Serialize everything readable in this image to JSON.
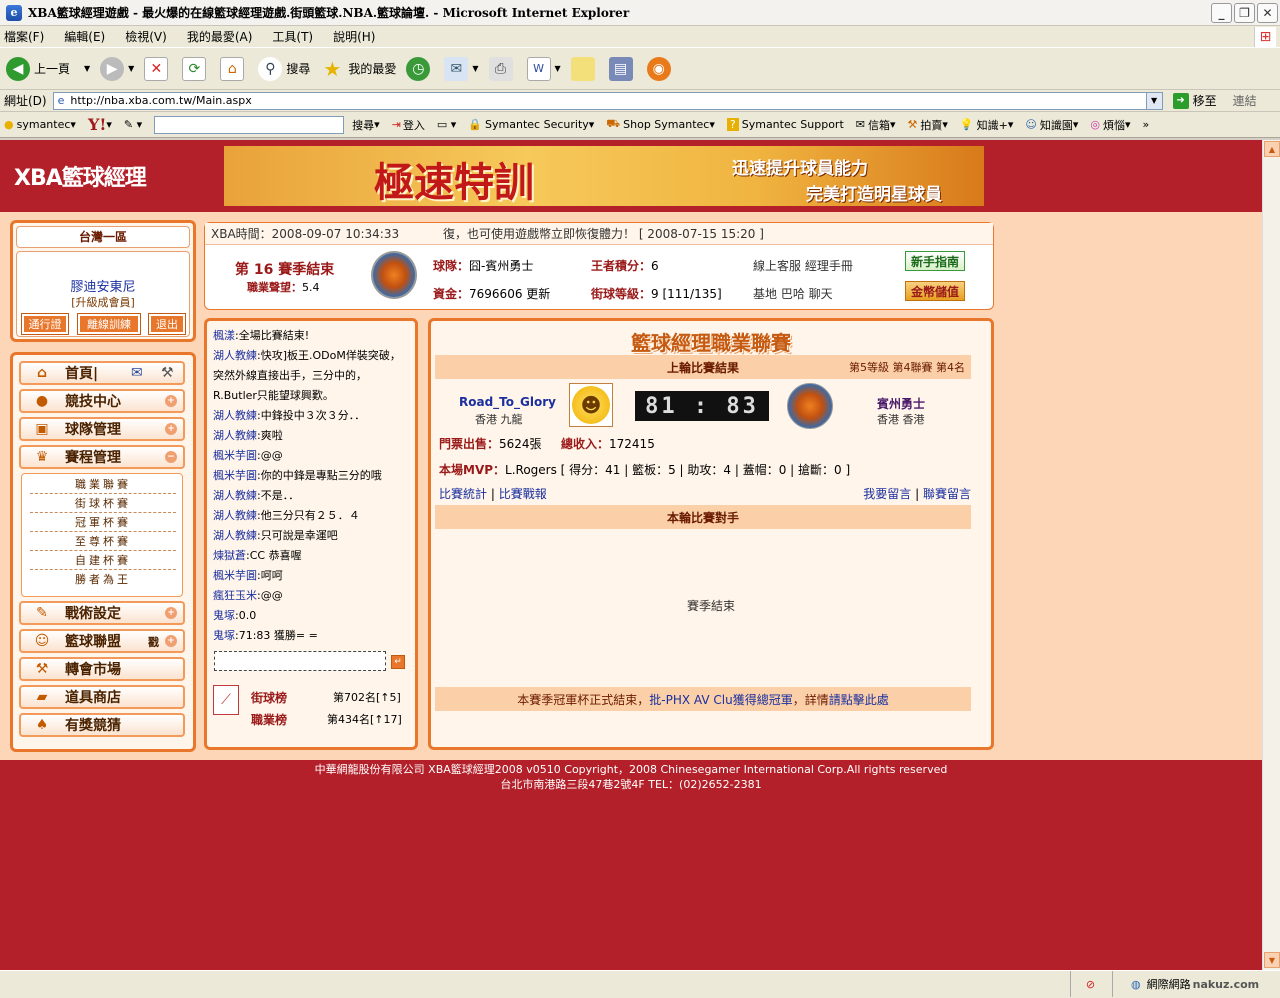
{
  "window": {
    "title": "XBA籃球經理遊戲 - 最火爆的在線籃球經理遊戲.街頭籃球.NBA.籃球論壇. - Microsoft Internet Explorer"
  },
  "menu": [
    "檔案(F)",
    "編輯(E)",
    "檢視(V)",
    "我的最愛(A)",
    "工具(T)",
    "說明(H)"
  ],
  "toolbar": {
    "back": "上一頁",
    "search": "搜尋",
    "favorites": "我的最愛"
  },
  "address": {
    "label": "網址(D)",
    "url": "http://nba.xba.com.tw/Main.aspx",
    "go": "移至",
    "links": "連結"
  },
  "symantec_bar": {
    "brand": "symantec",
    "yahoo": "Y!",
    "search": "搜尋",
    "login": "登入",
    "security": "Symantec Security",
    "shop": "Shop Symantec",
    "support": "Symantec Support",
    "mail": "信箱",
    "auction": "拍賣",
    "knowledge": "知識+",
    "knowledge_garden": "知識園",
    "trouble": "煩惱"
  },
  "site": {
    "logo": "XBA籃球經理",
    "banner": {
      "headline": "極速特訓",
      "line1": "迅速提升球員能力",
      "line2": "完美打造明星球員"
    },
    "user": {
      "region": "台灣一區",
      "name": "膠迪安東尼",
      "level": "[升級成會員]",
      "btn1": "通行證",
      "btn2": "離線訓練",
      "btn3": "退出"
    },
    "nav": [
      {
        "label": "首頁|",
        "icon": "home-icon"
      },
      {
        "label": "競技中心",
        "icon": "basketball-icon"
      },
      {
        "label": "球隊管理",
        "icon": "team-icon"
      },
      {
        "label": "賽程管理",
        "icon": "trophy-icon"
      }
    ],
    "subnav": [
      "職業聯賽",
      "街球杯賽",
      "冠軍杯賽",
      "至尊杯賽",
      "自建杯賽",
      "勝者為王"
    ],
    "nav2": [
      {
        "label": "戰術設定",
        "icon": "tactics-icon"
      },
      {
        "label": "籃球聯盟",
        "icon": "league-icon",
        "extra": "戳"
      },
      {
        "label": "轉會市場",
        "icon": "hammer-icon"
      },
      {
        "label": "道具商店",
        "icon": "shop-icon"
      },
      {
        "label": "有獎競猜",
        "icon": "spade-icon"
      }
    ],
    "info": {
      "time": "XBA時間：2008-09-07 10:34:33",
      "notice": "復，也可使用遊戲幣立即恢復體力！ [ 2008-07-15 15:20 ]",
      "season": "第 16 賽季結束",
      "pro_label": "職業聲望：",
      "pro_value": "5.4",
      "team_label": "球隊：",
      "team_value": "囧-賓州勇士",
      "king_label": "王者積分：",
      "king_value": "6",
      "links1": "線上客服  經理手冊",
      "money_label": "資金：",
      "money_value": "7696606",
      "refresh": "更新",
      "street_label": "街球等級：",
      "street_value": "9 [111/135]",
      "links2": "基地  巴哈  聊天",
      "newbie_btn": "新手指南",
      "deposit_btn": "金幣儲值"
    },
    "chat": [
      {
        "who": "楓漾",
        "msg": ":全場比賽結束!"
      },
      {
        "who": "湖人教練",
        "msg": ":快攻]板王.ODoM佯裝突破，突然外線直接出手，三分中的，R.Butler只能望球興歎。"
      },
      {
        "who": "湖人教練",
        "msg": ":中鋒投中３次３分．．"
      },
      {
        "who": "湖人教練",
        "msg": ":爽啦"
      },
      {
        "who": "楓米芋圓",
        "msg": ":@@"
      },
      {
        "who": "楓米芋圓",
        "msg": ":你的中鋒是專點三分的哦"
      },
      {
        "who": "湖人教練",
        "msg": ":不是．．"
      },
      {
        "who": "湖人教練",
        "msg": ":他三分只有２５．４"
      },
      {
        "who": "湖人教練",
        "msg": ":只可說是幸運吧"
      },
      {
        "who": "煉獄蒼",
        "msg": ":CC 恭喜喔"
      },
      {
        "who": "楓米芋圓",
        "msg": ":呵呵"
      },
      {
        "who": "瘋狂玉米",
        "msg": ":@@"
      },
      {
        "who": "鬼塚",
        "msg": ":0.0"
      },
      {
        "who": "鬼塚",
        "msg": ":71:83 獲勝= ="
      }
    ],
    "rank": {
      "street_label": "街球榜",
      "street_value": "第702名[↑5]",
      "pro_label": "職業榜",
      "pro_value": "第434名[↑17]"
    },
    "league": {
      "title": "籃球經理職業聯賽",
      "last_round": "上輪比賽結果",
      "level_info": "第5等級  第4聯賽  第4名",
      "home_team": "Road_To_Glory",
      "home_loc": "香港 九龍",
      "score": "81 : 83",
      "away_team": "賓州勇士",
      "away_loc": "香港 香港",
      "ticket_label": "門票出售：",
      "ticket_value": "5624張",
      "income_label": "總收入：",
      "income_value": "172415",
      "mvp_label": "本場MVP：",
      "mvp_value": "L.Rogers [ 得分：41 | 籃板：5 | 助攻：4 | 蓋帽：0 | 搶斷：0 ]",
      "stats": "比賽統計",
      "report": "比賽戰報",
      "my_msg": "我要留言",
      "league_msg": "聯賽留言",
      "this_round": "本輪比賽對手",
      "season_end": "賽季結束",
      "cup_notice_a": "本賽季冠軍杯正式結束，",
      "cup_notice_b": "批-PHX AV Clu獲得總冠軍",
      "cup_notice_c": "，詳情",
      "cup_notice_d": "請點擊此處"
    },
    "footer": {
      "line1": "中華網龍股份有限公司  XBA籃球經理2008 v0510     Copyright，2008 Chinesegamer International Corp.All rights reserved",
      "line2": "台北市南港路三段47巷2號4F TEL：(02)2652-2381"
    }
  },
  "status": {
    "zone": "網際網路",
    "watermark": "nakuz.com"
  }
}
